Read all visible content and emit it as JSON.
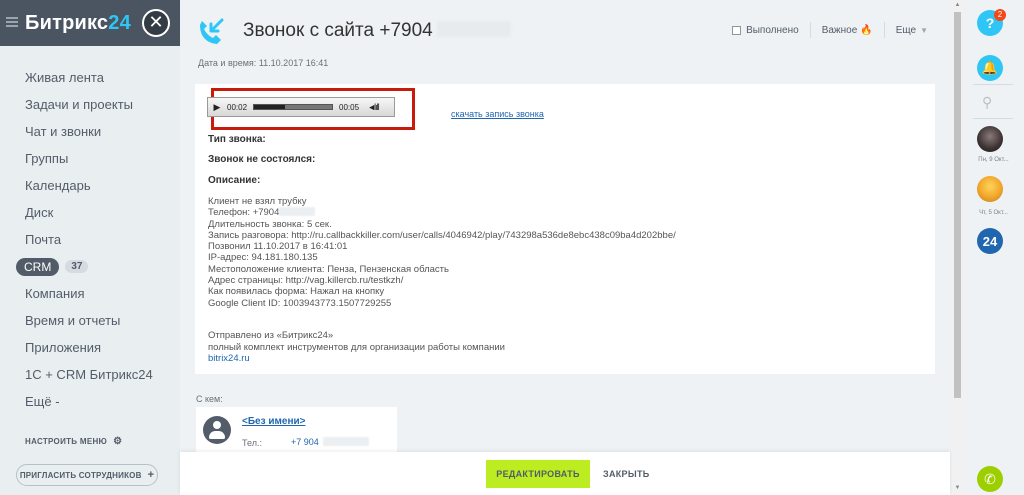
{
  "app": {
    "brand_main": "Битрикс",
    "brand_num": "24",
    "close_glyph": "✕"
  },
  "sidebar": {
    "items": [
      {
        "label": "Живая лента"
      },
      {
        "label": "Задачи и проекты"
      },
      {
        "label": "Чат и звонки"
      },
      {
        "label": "Группы"
      },
      {
        "label": "Календарь"
      },
      {
        "label": "Диск"
      },
      {
        "label": "Почта"
      },
      {
        "label": "CRM",
        "badge": "37"
      },
      {
        "label": "Компания"
      },
      {
        "label": "Время и отчеты"
      },
      {
        "label": "Приложения"
      },
      {
        "label": "1С + CRM Битрикс24"
      },
      {
        "label": "Ещё -"
      }
    ],
    "configure_label": "НАСТРОИТЬ МЕНЮ",
    "configure_icon": "gear-icon",
    "invite_label": "ПРИГЛАСИТЬ СОТРУДНИКОВ"
  },
  "header": {
    "title": "Звонок с сайта +7904",
    "datetime_label": "Дата и время:",
    "datetime_value": "11.10.2017 16:41",
    "completed_label": "Выполнено",
    "important_label": "Важное",
    "more_label": "Еще"
  },
  "player": {
    "current_time": "00:02",
    "total_time": "00:05",
    "progress": 0.4
  },
  "download_link": "скачать запись звонка",
  "fields": {
    "call_type": "Тип звонка:",
    "not_happened": "Звонок не состоялся:",
    "description": "Описание:"
  },
  "body_lines": [
    "Клиент не взял трубку",
    "Телефон: +7904",
    "Длительность звонка: 5 сек.",
    "Запись разговора: http://ru.callbackkiller.com/user/calls/4046942/play/743298a536de8ebc438c09ba4d202bbe/",
    "Позвонил 11.10.2017 в 16:41:01",
    "IP-адрес: 94.181.180.135",
    "Местоположение клиента: Пенза, Пензенская область",
    "Адрес страницы: http://vag.killercb.ru/testkzh/",
    "Как появилась форма: Нажал на кнопку",
    "Google Client ID: 1003943773.1507729255"
  ],
  "signature": {
    "line1": "Отправлено из «Битрикс24»",
    "line2": "полный комплект инструментов для организации работы компании",
    "link": "bitrix24.ru"
  },
  "contact": {
    "with_label": "С кем:",
    "name": "<Без имени>",
    "phone_label": "Тел.:",
    "phone": "+7 904"
  },
  "footer": {
    "edit_label": "РЕДАКТИРОВАТЬ",
    "close_label": "ЗАКРЫТЬ"
  },
  "rightbar": {
    "help_glyph": "?",
    "help_badge": "2",
    "avatar1_label": "Пн, 9 Окт...",
    "avatar2_label": "Чт, 5 Окт...",
    "b24_label": "24"
  },
  "colors": {
    "accent_blue": "#2fc6f6",
    "highlight_red": "#c91b0b",
    "edit_green": "#bbed21",
    "link_blue": "#2067b0"
  }
}
